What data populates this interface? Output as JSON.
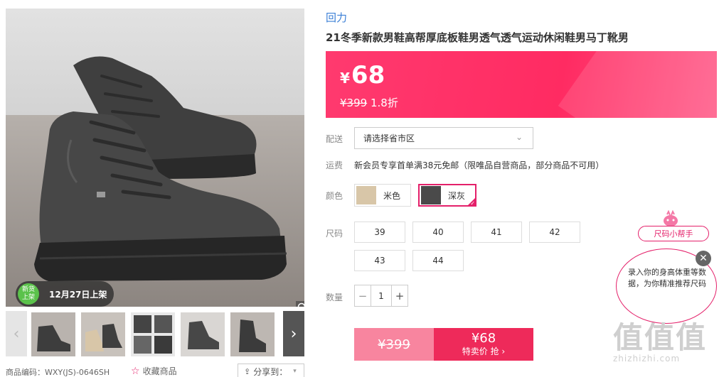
{
  "gallery": {
    "new_badge": {
      "circle_text": "新货\n上架",
      "date": "12月27日上架"
    },
    "thumbnails": [
      "thumb-1",
      "thumb-2",
      "thumb-3",
      "thumb-4",
      "thumb-5"
    ],
    "prod_code": "商品编码：WXY(JS)-0646SH",
    "favorite_label": "收藏商品",
    "share_label": "分享到："
  },
  "product": {
    "brand": "回力",
    "title": "21冬季新款男鞋高帮厚底板鞋男透气透气运动休闲鞋男马丁靴男"
  },
  "price": {
    "currency": "¥",
    "current": "68",
    "original": "¥399",
    "discount": "1.8折"
  },
  "delivery": {
    "label": "配送",
    "select_placeholder": "请选择省市区"
  },
  "shipping": {
    "label": "运费",
    "text": "新会员专享首单满38元免邮（限唯品自营商品，部分商品不可用）"
  },
  "colors": {
    "label": "颜色",
    "options": [
      {
        "name": "米色",
        "swatch": "#d8c6a8",
        "selected": false
      },
      {
        "name": "深灰",
        "swatch": "#4a4a4a",
        "selected": true
      }
    ]
  },
  "sizes": {
    "label": "尺码",
    "options": [
      "39",
      "40",
      "41",
      "42",
      "43",
      "44"
    ]
  },
  "quantity": {
    "label": "数量",
    "value": "1",
    "minus": "−",
    "plus": "+"
  },
  "buy": {
    "original_price": "¥399",
    "price": "¥68",
    "cta": "特卖价 抢 ›"
  },
  "size_helper": {
    "tag": "尺码小帮手",
    "text": "录入你的身高体重等数据，为你精准推荐尺码",
    "close": "✕"
  },
  "watermark": {
    "big": "值值值",
    "small": "zhizhizhi.com"
  },
  "colors_theme": {
    "accent": "#ee2a5a",
    "brand_link": "#3b7fd6"
  }
}
